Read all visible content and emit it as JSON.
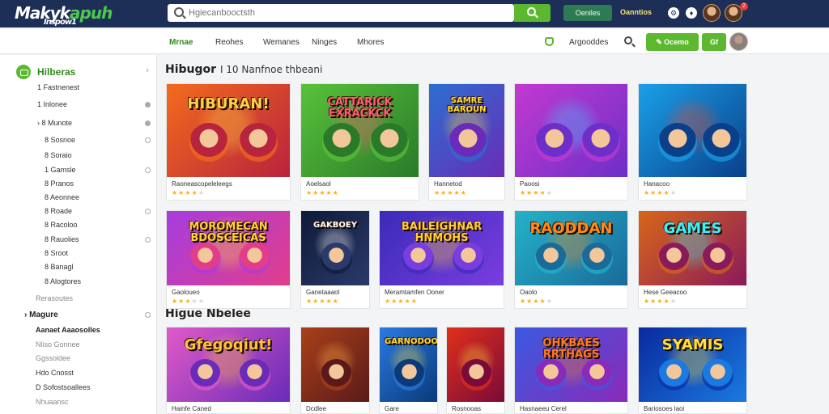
{
  "header": {
    "logo_main": "Makyk",
    "logo_accent": "apuh",
    "logo_sub": "Inspow1",
    "search_placeholder": "Hgiecanbooctsth",
    "action_label": "Oeniles",
    "link_label": "Oanntios",
    "notification_count": "2"
  },
  "nav": {
    "items": [
      {
        "label": "Mrnae",
        "active": true
      },
      {
        "label": "Reohes"
      },
      {
        "label": "Wemanes"
      },
      {
        "label": "Ninges"
      },
      {
        "label": "Mhores"
      }
    ],
    "right_label": "Argooddes",
    "primary_button": "Ocemo",
    "secondary_button": "Gf"
  },
  "sidebar": {
    "heading": "Hilberas",
    "items": [
      {
        "prefix": "1",
        "label": "Fastnenest"
      },
      {
        "prefix": "1",
        "label": "Inlonee"
      },
      {
        "prefix": "8",
        "label": "Munote"
      },
      {
        "prefix": "8",
        "label": "Sosnoe"
      },
      {
        "prefix": "8",
        "label": "Soraio"
      },
      {
        "prefix": "1",
        "label": "Gamsle"
      },
      {
        "prefix": "8",
        "label": "Pranos"
      },
      {
        "prefix": "8",
        "label": "Aeonnee"
      },
      {
        "prefix": "8",
        "label": "Roade"
      },
      {
        "prefix": "8",
        "label": "Racoloo"
      },
      {
        "prefix": "8",
        "label": "Rauolies"
      },
      {
        "prefix": "8",
        "label": "Sroot"
      },
      {
        "prefix": "8",
        "label": "Banagl"
      },
      {
        "prefix": "8",
        "label": "Alogtores"
      }
    ],
    "group_muted": "Rerasoutes",
    "group2_heading": "Magure",
    "group2_items": [
      {
        "label": "Aanaet Aaaosolles",
        "bold": true
      },
      {
        "label": "Nliso Gonnee",
        "muted": true
      },
      {
        "label": "Ggssoldee",
        "muted": true
      },
      {
        "label": "Hdo Cnosst"
      },
      {
        "label": "D Sofostsoallees"
      },
      {
        "label": "Nhuaansc",
        "muted": true
      }
    ]
  },
  "main": {
    "section1_title": "Hibugor",
    "section1_sub": "I 10 Nanfnoe thbeani",
    "section2_title": "Higue Nbelee"
  },
  "cards_row1": [
    {
      "thumb_text": "HIBURAN!",
      "title": "Raoneascopeleleegs",
      "rating": 4
    },
    {
      "thumb_text": "CATTARICK EXRACKCK",
      "title": "Aoelsaol",
      "rating": 5
    },
    {
      "thumb_text": "SAMRE BAROUN",
      "title": "Hannetod",
      "rating": 5
    },
    {
      "thumb_text": "",
      "title": "Paoosi",
      "rating": 4
    },
    {
      "thumb_text": "",
      "title": "Hanacoo",
      "rating": 4
    }
  ],
  "cards_row2": [
    {
      "thumb_text": "MOROMECAN BDOSCEICAS",
      "title": "Gaoloueo",
      "rating": 3
    },
    {
      "thumb_text": "GAKBOEY",
      "title": "Ganetaaaol",
      "rating": 5
    },
    {
      "thumb_text": "BAILEIGHNAR HNMOHS",
      "title": "Meramtamfen Ooner",
      "rating": 5
    },
    {
      "thumb_text": "RAODDAN",
      "title": "Oaolo",
      "rating": 4
    },
    {
      "thumb_text": "GAMES",
      "title": "Hese Geeacoo",
      "rating": 4
    }
  ],
  "cards_row3": [
    {
      "thumb_text": "Gfegoqiut!",
      "title": "Hainfe Caned"
    },
    {
      "thumb_text": "",
      "title": "Dcdlee"
    },
    {
      "thumb_text": "GARNODOO",
      "title": "Gare"
    },
    {
      "thumb_text": "",
      "title": "Rosnooas"
    },
    {
      "thumb_text": "OHKBAES RRTHAGS",
      "title": "Hasnaeeu Cerel"
    },
    {
      "thumb_text": "SYAMIS",
      "title": "Bariosoes laoi"
    }
  ],
  "colors": {
    "header_bg": "#1d2f57",
    "accent_green": "#5cb82e",
    "star": "#f4b01d"
  }
}
